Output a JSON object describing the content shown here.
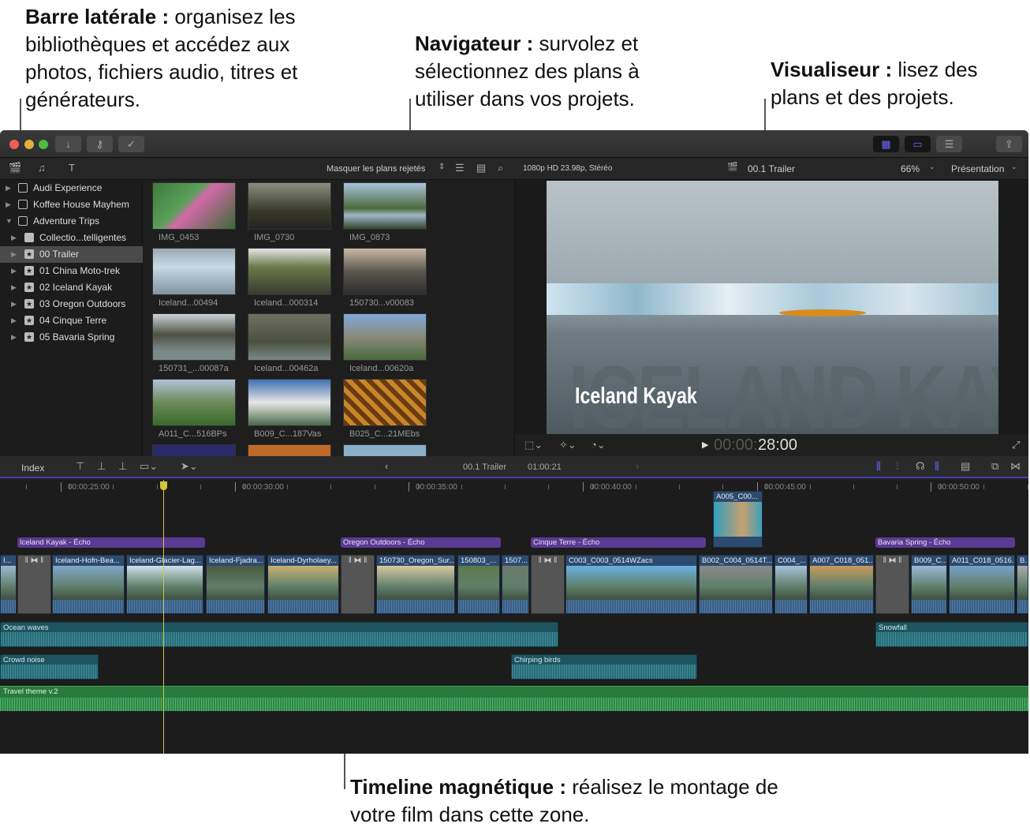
{
  "callouts": {
    "sidebar": {
      "bold": "Barre latérale :",
      "text": " organisez les bibliothèques et accédez aux photos, fichiers audio, titres et générateurs."
    },
    "browser": {
      "bold": "Navigateur :",
      "text": " survolez et sélectionnez des plans à utiliser dans vos projets."
    },
    "viewer": {
      "bold": "Visualiseur :",
      "text": " lisez des plans et des projets."
    },
    "timeline": {
      "bold": "Timeline magnétique :",
      "text": " réalisez le montage de votre film dans cette zone."
    }
  },
  "colors": {
    "accent": "#5b57e0",
    "title_clip": "#5a3b93",
    "video_clip": "#2d4b6e",
    "audio_clip": "#1e5460",
    "music_clip": "#2a7a3e",
    "playhead": "#d4c53a"
  },
  "toolbar": {
    "import_icon": "download-arrow-icon",
    "keyword_icon": "key-icon",
    "background_tasks_icon": "check-circle-icon",
    "share_icon": "share-icon"
  },
  "sidebar": {
    "items": [
      {
        "label": "Audi Experience",
        "icon": "library-icon"
      },
      {
        "label": "Koffee House Mayhem",
        "icon": "library-icon"
      },
      {
        "label": "Adventure Trips",
        "icon": "library-icon"
      },
      {
        "label": "Collectio...telligentes",
        "icon": "folder-icon"
      },
      {
        "label": "00 Trailer",
        "icon": "event-star-icon",
        "selected": true
      },
      {
        "label": "01 China Moto-trek",
        "icon": "event-star-icon"
      },
      {
        "label": "02 Iceland Kayak",
        "icon": "event-star-icon"
      },
      {
        "label": "03 Oregon Outdoors",
        "icon": "event-star-icon"
      },
      {
        "label": "04 Cinque Terre",
        "icon": "event-star-icon"
      },
      {
        "label": "05 Bavaria Spring",
        "icon": "event-star-icon"
      }
    ]
  },
  "browser": {
    "filter": "Masquer les plans rejetés",
    "clips": [
      "IMG_0453",
      "IMG_0730",
      "IMG_0873",
      "Iceland...00494",
      "Iceland...000314",
      "150730...v00083",
      "150731_...00087a",
      "Iceland...00462a",
      "Iceland...00620a",
      "A011_C...516BPs",
      "B009_C...187Vas",
      "B025_C...21MEbs"
    ]
  },
  "viewer": {
    "format": "1080p HD 23.98p, Stéréo",
    "project": "00.1 Trailer",
    "zoom": "66%",
    "view_menu": "Présentation",
    "overlay_title": "Iceland Kayak",
    "background_text": "ICELAND KAYAK",
    "timecode_dim": "00:00:",
    "timecode": "28:00"
  },
  "timeline": {
    "index_label": "Index",
    "project": "00.1 Trailer",
    "duration": "01:00:21",
    "ruler": [
      "00:00:25:00",
      "00:00:30:00",
      "00:00:35:00",
      "00:00:40:00",
      "00:00:45:00",
      "00:00:50:00"
    ],
    "titles": [
      "Iceland Kayak - Écho",
      "Oregon Outdoors - Écho",
      "Cinque Terre - Écho",
      "Bavaria Spring - Écho"
    ],
    "connected_clip": "A005_C00...",
    "clips": [
      "I...",
      "Iceland-Hofn-Bea...",
      "Iceland-Glacier-Lag...",
      "Iceland-Fjadra...",
      "Iceland-Dyrholaey...",
      "150730_Oregon_Sur...",
      "150803_...",
      "1507...",
      "C003_C003_0514WZacs",
      "B002_C004_0514T...",
      "C004_...",
      "A007_C018_051...",
      "B009_C...",
      "A011_C018_0516...",
      "B..."
    ],
    "audio": [
      "Ocean waves",
      "Crowd noise",
      "Chirping birds",
      "Snowfall"
    ],
    "music": "Travel theme v.2"
  }
}
